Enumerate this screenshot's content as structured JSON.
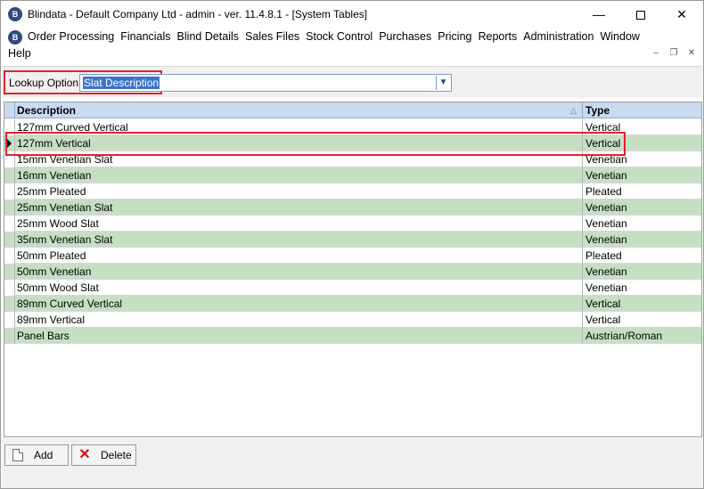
{
  "window": {
    "title": "Blindata - Default Company Ltd - admin - ver. 11.4.8.1 - [System Tables]",
    "app_icon": "blindata-logo-icon",
    "controls": {
      "minimize": "—",
      "maximize": "",
      "close": "✕"
    }
  },
  "menu": {
    "items": [
      "Order Processing",
      "Financials",
      "Blind Details",
      "Sales Files",
      "Stock Control",
      "Purchases",
      "Pricing",
      "Reports",
      "Administration",
      "Window"
    ],
    "help": "Help",
    "mdi_controls": {
      "minimize": "–",
      "restore": "❐",
      "close": "✕"
    }
  },
  "lookup": {
    "label": "Lookup Option:",
    "value": "Slat Description"
  },
  "grid": {
    "columns": {
      "description": "Description",
      "type": "Type"
    },
    "sort_indicator": "△",
    "rows": [
      {
        "description": "127mm Curved Vertical",
        "type": "Vertical"
      },
      {
        "description": "127mm Vertical",
        "type": "Vertical"
      },
      {
        "description": "15mm Venetian Slat",
        "type": "Venetian"
      },
      {
        "description": "16mm Venetian",
        "type": "Venetian"
      },
      {
        "description": "25mm Pleated",
        "type": "Pleated"
      },
      {
        "description": "25mm Venetian Slat",
        "type": "Venetian"
      },
      {
        "description": "25mm Wood Slat",
        "type": "Venetian"
      },
      {
        "description": "35mm Venetian Slat",
        "type": "Venetian"
      },
      {
        "description": "50mm Pleated",
        "type": "Pleated"
      },
      {
        "description": "50mm Venetian",
        "type": "Venetian"
      },
      {
        "description": "50mm Wood Slat",
        "type": "Venetian"
      },
      {
        "description": "89mm Curved Vertical",
        "type": "Vertical"
      },
      {
        "description": "89mm Vertical",
        "type": "Vertical"
      },
      {
        "description": "Panel Bars",
        "type": "Austrian/Roman"
      }
    ],
    "current_row_index": 1
  },
  "buttons": {
    "add": "Add",
    "delete": "Delete"
  },
  "colors": {
    "row_alt": "#c6dfc4",
    "header": "#c9daf1",
    "highlight": "#e0222d",
    "selection": "#3b73c7"
  }
}
